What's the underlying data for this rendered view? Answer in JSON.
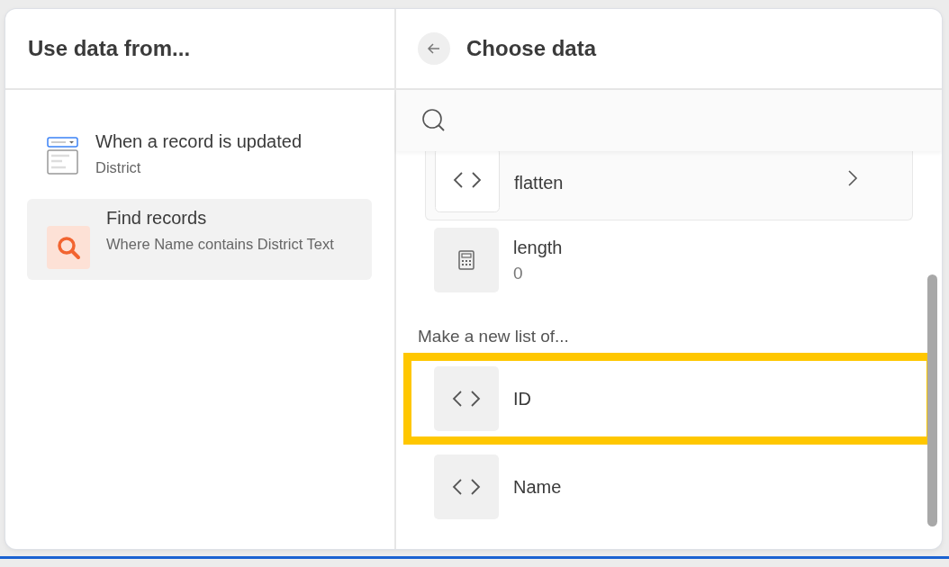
{
  "left_panel": {
    "title": "Use data from...",
    "sources": [
      {
        "kind": "trigger",
        "title": "When a record is updated",
        "subtitle": "District",
        "selected": false
      },
      {
        "kind": "search",
        "title": "Find records",
        "subtitle": "Where Name contains District Text",
        "selected": true
      }
    ]
  },
  "right_panel": {
    "title": "Choose data",
    "items": [
      {
        "kind": "code",
        "label": "flatten",
        "expandable": true
      },
      {
        "kind": "number",
        "label": "length",
        "value": "0",
        "expandable": false
      }
    ],
    "section_title": "Make a new list of...",
    "list_fields": [
      {
        "kind": "code",
        "label": "ID",
        "highlighted": true
      },
      {
        "kind": "code",
        "label": "Name",
        "highlighted": false
      }
    ]
  }
}
